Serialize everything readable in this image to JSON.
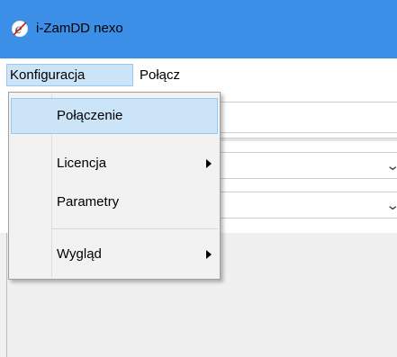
{
  "window": {
    "title": "i-ZamDD nexo",
    "icon": "app-logo-icon",
    "titlebar_color": "#3c8fe6"
  },
  "menubar": {
    "items": [
      {
        "label": "Konfiguracja",
        "active": true
      },
      {
        "label": "Połącz",
        "active": false
      }
    ]
  },
  "dropdown": {
    "items": [
      {
        "label": "Połączenie",
        "highlighted": true,
        "submenu": false
      },
      {
        "label": "Licencja",
        "highlighted": false,
        "submenu": true
      },
      {
        "label": "Parametry",
        "highlighted": false,
        "submenu": false
      },
      {
        "label": "Wygląd",
        "highlighted": false,
        "submenu": true
      }
    ]
  },
  "colors": {
    "highlight": "#cce4f7",
    "highlight_border": "#99c9ef",
    "menu_background": "#f2f2f2"
  }
}
